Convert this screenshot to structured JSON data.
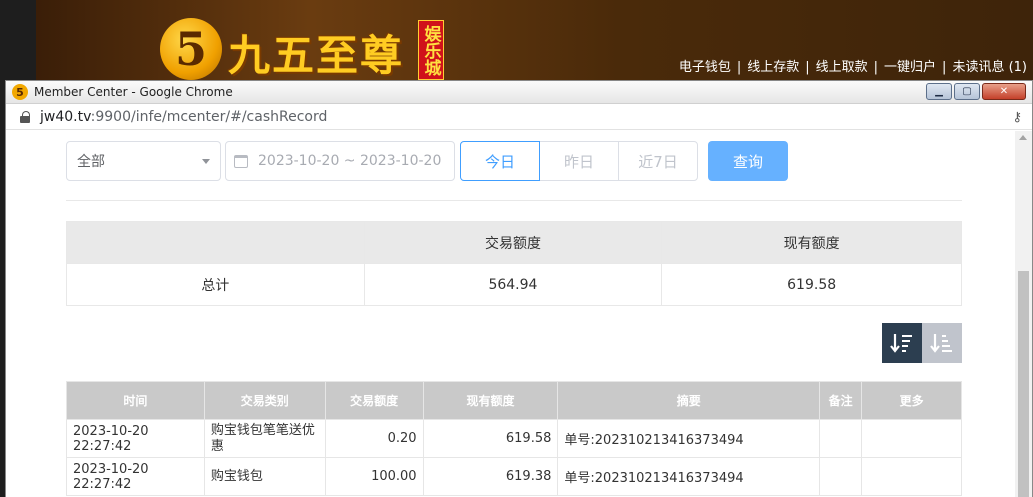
{
  "site": {
    "logo_mark": "5",
    "logo_text": "九五至尊",
    "logo_badge": "娱乐城",
    "nav": [
      "电子钱包",
      "线上存款",
      "线上取款",
      "一键归户",
      "未读讯息 (1)"
    ]
  },
  "window": {
    "title": "Member Center - Google Chrome",
    "url_host": "jw40.tv",
    "url_path": ":9900/infe/mcenter/#/cashRecord"
  },
  "filters": {
    "type_select": "全部",
    "date_range": "2023-10-20 ~ 2023-10-20",
    "quick_ranges": [
      "今日",
      "昨日",
      "近7日"
    ],
    "active_range": "今日",
    "query_label": "查询"
  },
  "summary": {
    "headers": [
      "",
      "交易额度",
      "现有额度"
    ],
    "row_label": "总计",
    "trade_amount": "564.94",
    "current_amount": "619.58"
  },
  "records": {
    "headers": [
      "时间",
      "交易类别",
      "交易额度",
      "现有额度",
      "摘要",
      "备注",
      "更多"
    ],
    "rows": [
      {
        "time": "2023-10-20 22:27:42",
        "type": "购宝钱包笔笔送优惠",
        "amount": "0.20",
        "balance": "619.58",
        "summary": "单号:202310213416373494",
        "note": "",
        "more": ""
      },
      {
        "time": "2023-10-20 22:27:42",
        "type": "购宝钱包",
        "amount": "100.00",
        "balance": "619.38",
        "summary": "单号:202310213416373494",
        "note": "",
        "more": ""
      }
    ]
  },
  "icons": {
    "sort_desc": "sort-descending-icon",
    "sort_asc": "sort-ascending-icon"
  }
}
